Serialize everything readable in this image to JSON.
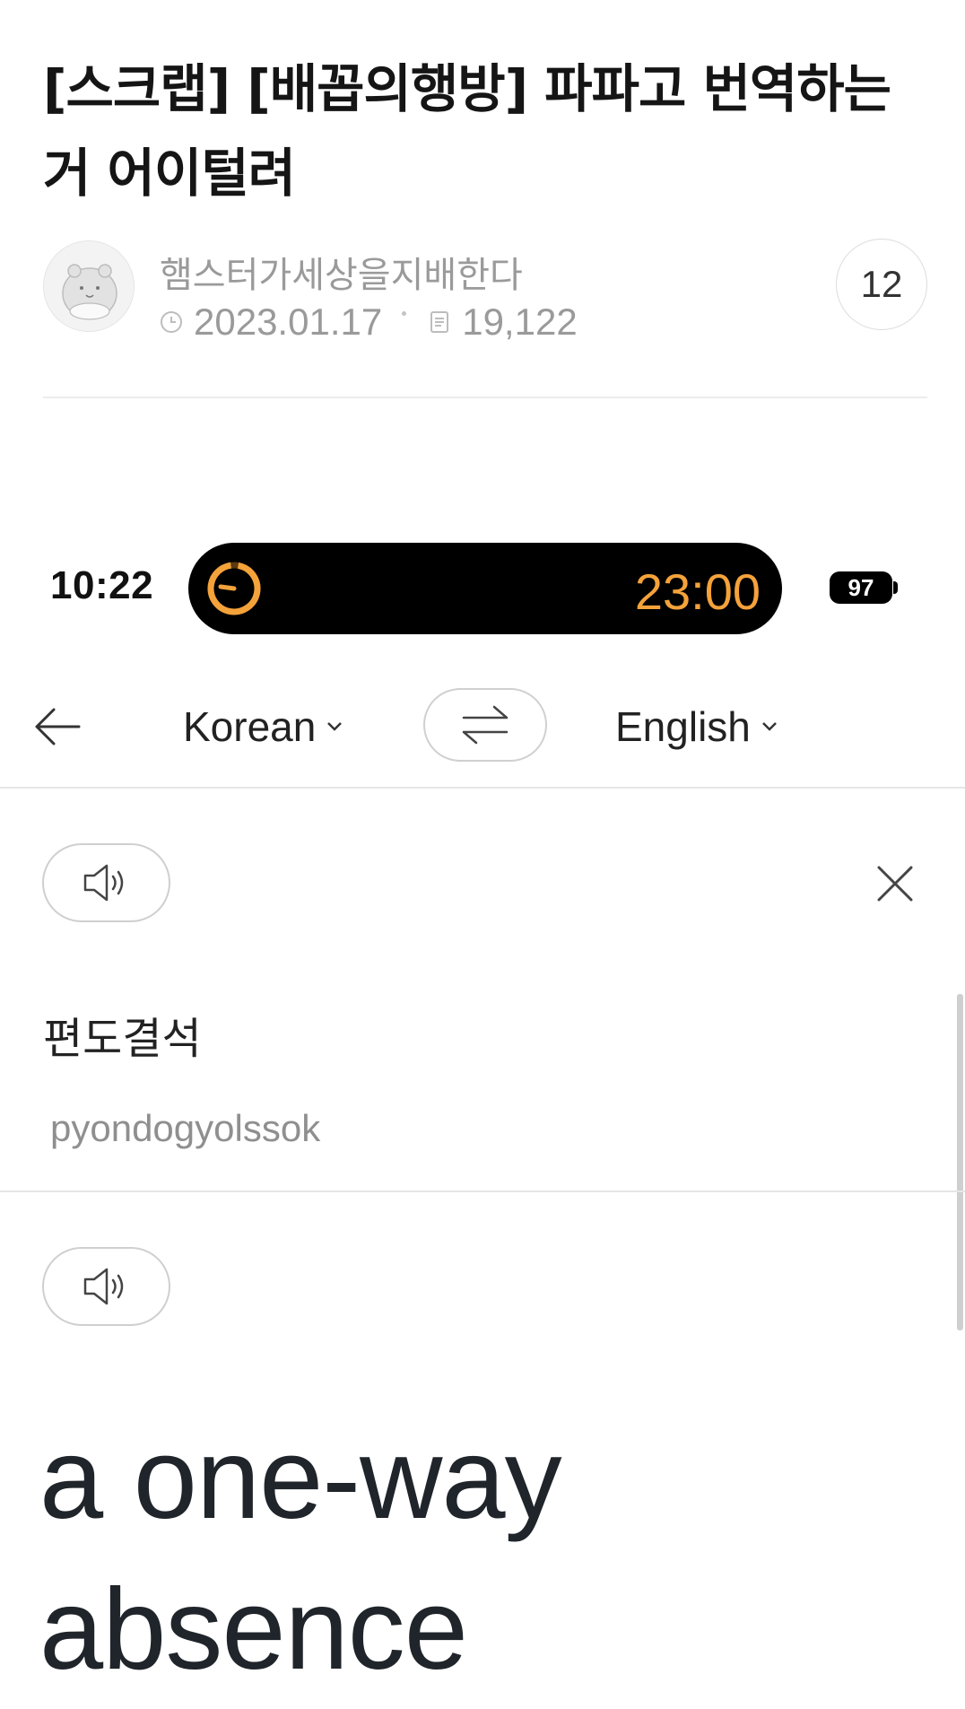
{
  "post": {
    "title": "[스크랩] [배꼽의행방] 파파고 번역하는 거 어이털려",
    "author": "햄스터가세상을지배한다",
    "date": "2023.01.17",
    "views": "19,122",
    "comments": "12",
    "icons": {
      "date": "clock-icon",
      "views": "document-icon",
      "avatar": "hamster-avatar"
    }
  },
  "status_bar": {
    "time": "10:22",
    "timer": "23:00",
    "battery": "97",
    "accent_color": "#f4a23a"
  },
  "translator": {
    "source_lang": "Korean",
    "target_lang": "English",
    "source_text": "편도결석",
    "romanization": "pyondogyolssok",
    "translation": "a one-way absence",
    "icons": {
      "back": "arrow-left-icon",
      "swap": "swap-arrows-icon",
      "speak": "speaker-icon",
      "close": "close-icon",
      "dropdown": "chevron-down-icon"
    }
  }
}
